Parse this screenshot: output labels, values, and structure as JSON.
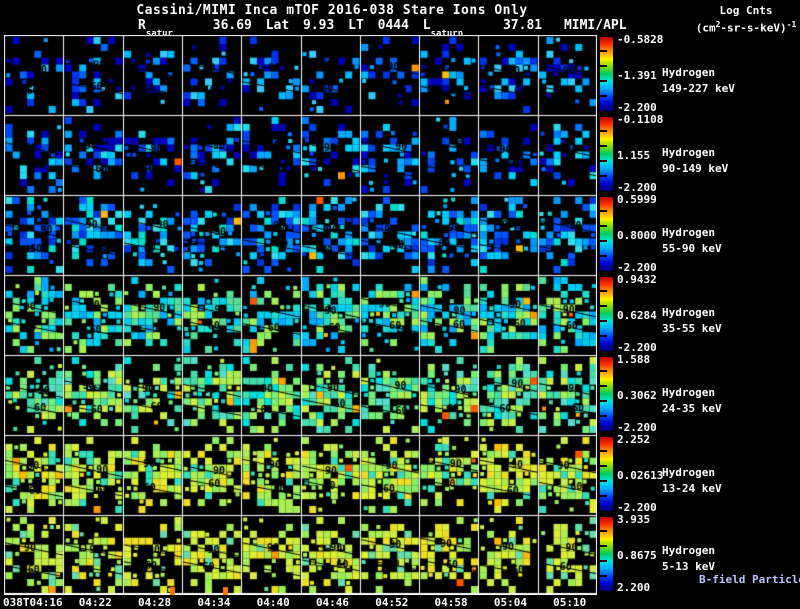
{
  "title": {
    "line1": "Cassini/MIMI Inca mTOF  2016-038   Stare   Ions Only",
    "line2": {
      "r_label": "R",
      "r_sub": "satur",
      "r_value": "36.69",
      "lat_label": "Lat",
      "lat_value": "9.93",
      "lt_label": "LT",
      "lt_value": "0444",
      "l_label": "L",
      "l_sub": "saturn",
      "l_value": "37.81",
      "org": "MIMI/APL"
    }
  },
  "legend": {
    "line1": "Log Cnts",
    "unit_prefix": "(cm",
    "unit_sup2": "2",
    "unit_mid": "-sr-s-keV)",
    "unit_exp": "-1"
  },
  "rows": [
    {
      "species": "Hydrogen",
      "energy": "149-227 keV",
      "cb_top": "-0.5828",
      "cb_mid": "-1.391",
      "cb_bot": "-2.200",
      "contours": [
        "90",
        "60"
      ]
    },
    {
      "species": "Hydrogen",
      "energy": "90-149 keV",
      "cb_top": "-0.1108",
      "cb_mid": "1.155",
      "cb_bot": "-2.200",
      "contours": [
        "90",
        "60"
      ]
    },
    {
      "species": "Hydrogen",
      "energy": "55-90 keV",
      "cb_top": "0.5999",
      "cb_mid": "0.8000",
      "cb_bot": "-2.200",
      "contours": [
        "90",
        "60"
      ]
    },
    {
      "species": "Hydrogen",
      "energy": "35-55 keV",
      "cb_top": "0.9432",
      "cb_mid": "0.6284",
      "cb_bot": "-2.200",
      "contours": [
        "90",
        "60"
      ]
    },
    {
      "species": "Hydrogen",
      "energy": "24-35 keV",
      "cb_top": "1.588",
      "cb_mid": "0.3062",
      "cb_bot": "-2.200",
      "contours": [
        "90",
        "60"
      ]
    },
    {
      "species": "Hydrogen",
      "energy": "13-24 keV",
      "cb_top": "2.252",
      "cb_mid": "0.02613",
      "cb_bot": "-2.200",
      "contours": [
        "90",
        "60"
      ]
    },
    {
      "species": "Hydrogen",
      "energy": "5-13 keV",
      "cb_top": "3.935",
      "cb_mid": "0.8675",
      "cb_bot": "2.200",
      "contours": [
        "90",
        "60"
      ]
    }
  ],
  "bfield_label": "B-field Particle Flow",
  "colorbar_colors": [
    "#bb0000",
    "#ff3300",
    "#ff9900",
    "#ffee00",
    "#77dd00",
    "#00cc66",
    "#00e5e5",
    "#00aaff",
    "#0044ff",
    "#0000cc",
    "#000077"
  ],
  "x_axis": {
    "labels": [
      "038T04:16",
      "04:22",
      "04:28",
      "04:34",
      "04:40",
      "04:46",
      "04:52",
      "04:58",
      "05:04",
      "05:10"
    ]
  },
  "axis_markers": [
    {
      "x": 170,
      "color": "#ff7700"
    },
    {
      "x": 223,
      "color": "#ff7700"
    }
  ],
  "chart_data": {
    "type": "heatmap",
    "title": "Cassini/MIMI Inca mTOF 2016-038 Stare Ions Only",
    "subtitle": "R_saturn 36.69 Lat 9.93 LT 0444 L_saturn 37.81 MIMI/APL",
    "colorbar_units": "Log Cnts (cm2-sr-s-keV)-1",
    "x_tick_labels": [
      "038T04:16",
      "04:22",
      "04:28",
      "04:34",
      "04:40",
      "04:46",
      "04:52",
      "04:58",
      "05:04",
      "05:10"
    ],
    "panels_per_row": 10,
    "contour_line_labels_deg": [
      90,
      60
    ],
    "series": [
      {
        "name": "Hydrogen 149-227 keV",
        "colorbar_range_log": [
          -2.2,
          -0.5828
        ],
        "colorbar_mid": -1.391
      },
      {
        "name": "Hydrogen 90-149 keV",
        "colorbar_range_log": [
          -2.2,
          -0.1108
        ],
        "colorbar_mid": 1.155
      },
      {
        "name": "Hydrogen 55-90 keV",
        "colorbar_range_log": [
          -2.2,
          0.5999
        ],
        "colorbar_mid": 0.8
      },
      {
        "name": "Hydrogen 35-55 keV",
        "colorbar_range_log": [
          -2.2,
          0.9432
        ],
        "colorbar_mid": 0.6284
      },
      {
        "name": "Hydrogen 24-35 keV",
        "colorbar_range_log": [
          -2.2,
          1.588
        ],
        "colorbar_mid": 0.3062
      },
      {
        "name": "Hydrogen 13-24 keV",
        "colorbar_range_log": [
          -2.2,
          2.252
        ],
        "colorbar_mid": 0.02613
      },
      {
        "name": "Hydrogen 5-13 keV",
        "colorbar_range_log": [
          2.2,
          3.935
        ],
        "colorbar_mid": 0.8675
      }
    ],
    "legend_position": "right",
    "grid": true
  }
}
